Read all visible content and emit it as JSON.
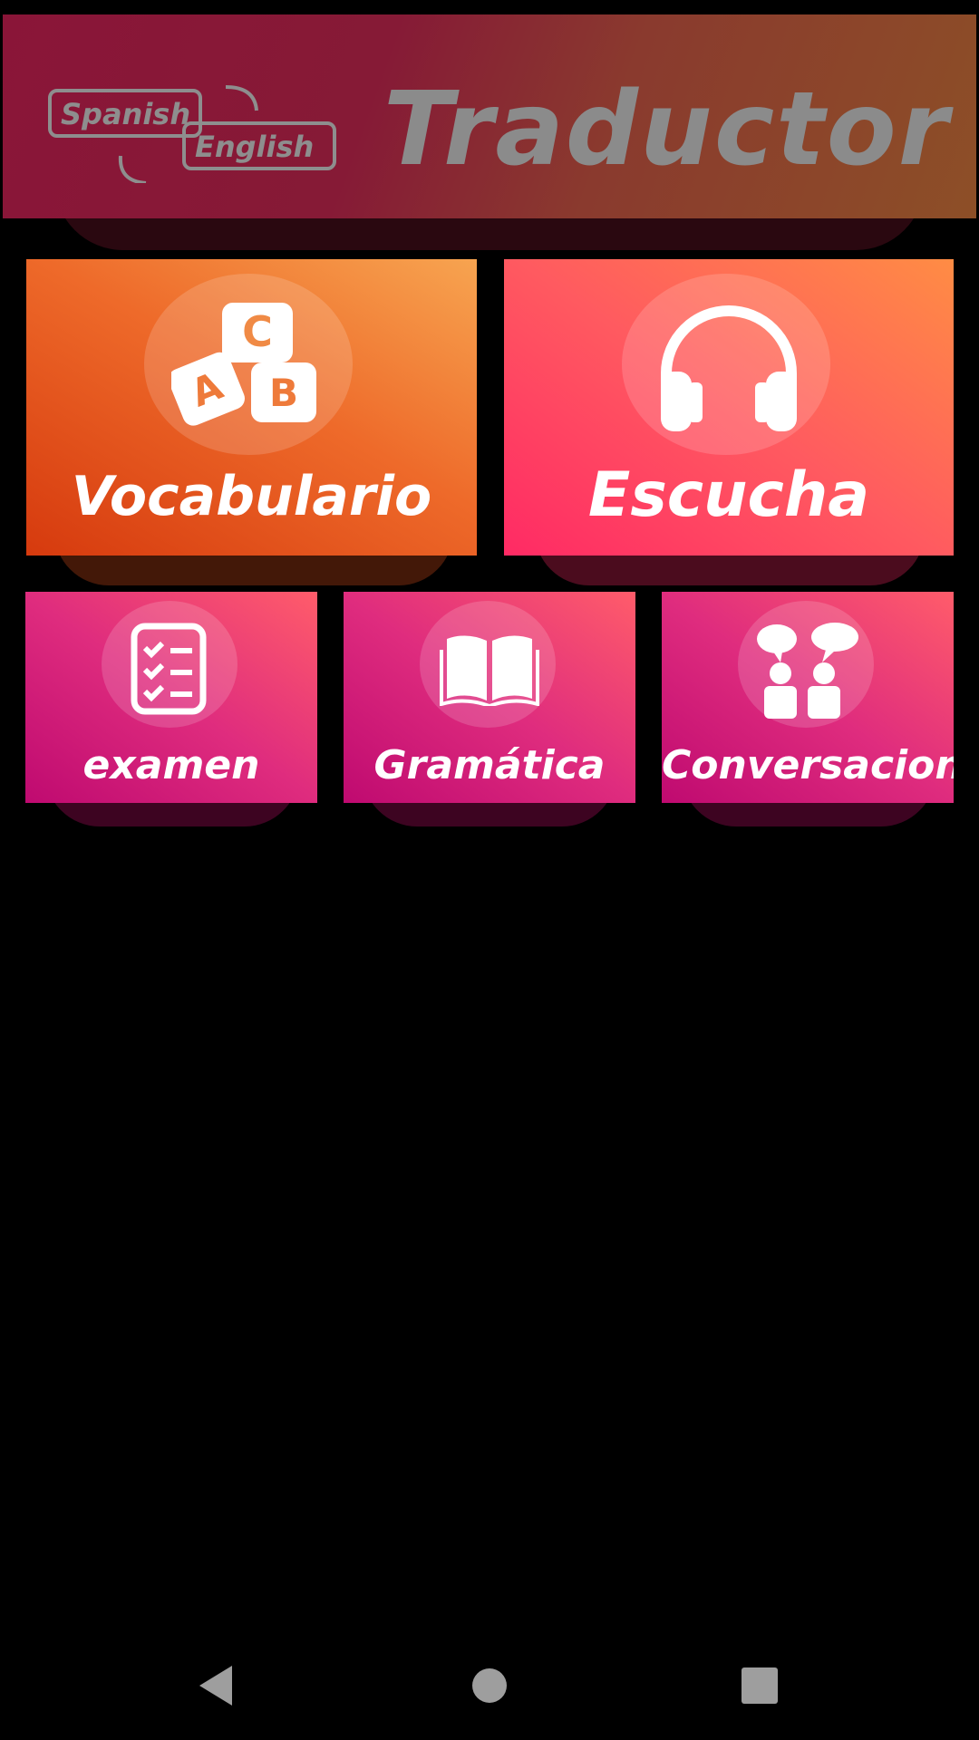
{
  "header": {
    "badge_top": "Spanish",
    "badge_bottom": "English",
    "title": "Traductor"
  },
  "tiles": [
    {
      "label": "Vocabulario",
      "icon": "abc-blocks-icon"
    },
    {
      "label": "Escucha",
      "icon": "headphones-icon"
    },
    {
      "label": "examen",
      "icon": "checklist-icon"
    },
    {
      "label": "Gramática",
      "icon": "open-book-icon"
    },
    {
      "label": "Conversacion",
      "icon": "conversation-icon"
    }
  ],
  "navbar": {
    "back": "back-icon",
    "home": "home-icon",
    "recents": "recents-icon"
  },
  "colors": {
    "background": "#000000",
    "banner_left": "#8a1538",
    "banner_right": "#8d4f27",
    "vocab": "#ee6a2a",
    "escucha": "#ff5a60",
    "small_tiles": "#df2c7e",
    "nav_icons": "#9e9e9e"
  }
}
